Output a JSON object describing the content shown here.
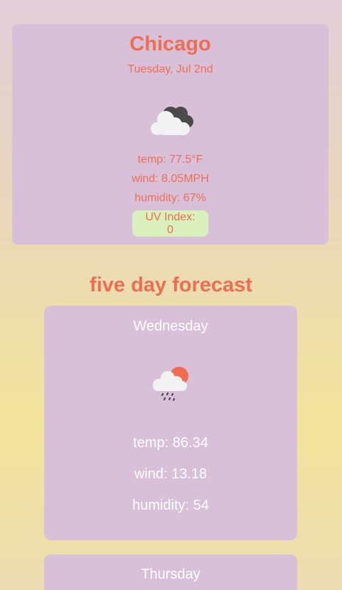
{
  "current": {
    "city": "Chicago",
    "date": "Tuesday, Jul 2nd",
    "icon": "cloudy-icon",
    "temp": "temp: 77.5°F",
    "wind": "wind: 8.05MPH",
    "humidity": "humidity: 67%",
    "uv_label": "UV Index:",
    "uv_value": "0",
    "colors": {
      "card_bg": "#d9c0d9",
      "accent": "#ee6e52",
      "uv_bg": "#d9f0bc"
    }
  },
  "forecast": {
    "title": "five day forecast",
    "days": [
      {
        "day": "Wednesday",
        "icon": "rain-sun-icon",
        "temp": "temp: 86.34",
        "wind": "wind: 13.18",
        "humidity": "humidity: 54"
      },
      {
        "day": "Thursday"
      }
    ]
  }
}
